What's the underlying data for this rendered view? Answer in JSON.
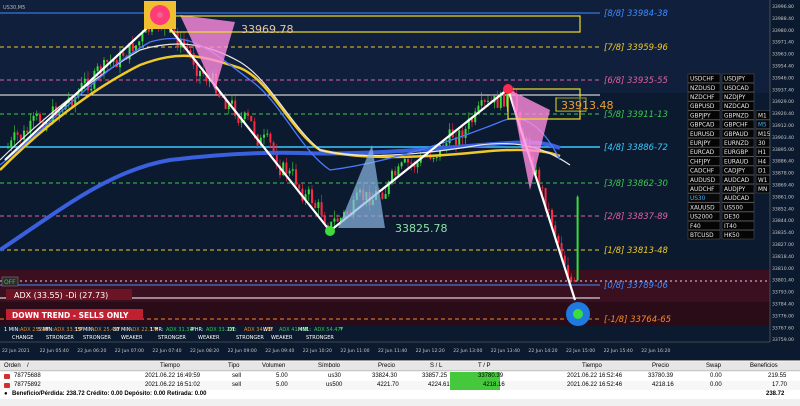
{
  "chart": {
    "title": "US30,M5",
    "labels": {
      "top_box": "33969.78",
      "right_box": "33913.48",
      "bottom_box": "33825.78"
    },
    "levels": [
      {
        "text": "[8/8]  33984-38",
        "color": "#3c8cff"
      },
      {
        "text": "[7/8]  33959-96",
        "color": "#f0c828"
      },
      {
        "text": "[6/8]  33935-55",
        "color": "#e060a0"
      },
      {
        "text": "[5/8]  33911-13",
        "color": "#3cc850"
      },
      {
        "text": "[4/8]  33886-72",
        "color": "#3cc8ff"
      },
      {
        "text": "[3/8]  33862-30",
        "color": "#3cc850"
      },
      {
        "text": "[2/8]  33837-89",
        "color": "#e060a0"
      },
      {
        "text": "[1/8]  33813-48",
        "color": "#f0c828"
      },
      {
        "text": "[0/8]  33789-06",
        "color": "#3c8cff"
      },
      {
        "text": "[-1/8]  33764-65",
        "color": "#f08a28"
      }
    ],
    "price_ticks": [
      "33996.80",
      "33988.40",
      "33980.00",
      "33971.40",
      "33963.00",
      "33954.40",
      "33946.00",
      "33937.40",
      "33929.00",
      "33920.40",
      "33912.00",
      "33903.40",
      "33895.00",
      "33886.40",
      "33878.00",
      "33869.40",
      "33861.00",
      "33852.40",
      "33844.00",
      "33835.40",
      "33827.00",
      "33818.40",
      "33810.00",
      "33801.40",
      "33793.00",
      "33784.40",
      "33776.00",
      "33767.60",
      "33759.00"
    ],
    "time_ticks": [
      "22 Jun 2021",
      "22 Jun 05:40",
      "22 Jun 06:20",
      "22 Jun 07:00",
      "22 Jun 07:40",
      "22 Jun 08:20",
      "22 Jun 09:00",
      "22 Jun 09:40",
      "22 Jun 10:20",
      "22 Jun 11:00",
      "22 Jun 11:40",
      "22 Jun 12:20",
      "22 Jun 13:00",
      "22 Jun 13:40",
      "22 Jun 14:20",
      "22 Jun 15:00",
      "22 Jun 15:40",
      "22 Jun 16:20"
    ],
    "adx_label": "ADX (33.55)  -Di (27.73)",
    "trend_label": "DOWN TREND - SELLS ONLY",
    "off_label": "OFF",
    "timeframes": [
      {
        "tf": "1 MIN:",
        "adx": "ADX 25.50",
        "state": "CHANGE",
        "color": "#f08a28"
      },
      {
        "tf": "5 MIN:",
        "adx": "ADX 33.55",
        "state": "STRONGER",
        "color": "#f08a28"
      },
      {
        "tf": "15 MIN:",
        "adx": "ADX 25.40",
        "state": "STRONGER",
        "color": "#f08a28"
      },
      {
        "tf": "30 MIN:",
        "adx": "ADX 22.37",
        "state": "WEAKER",
        "color": "#f08a28"
      },
      {
        "tf": "1 HR:",
        "adx": "ADX 31.31",
        "state": "STRONGER",
        "color": "#3cc850"
      },
      {
        "tf": "4 HR:",
        "adx": "ADX 33.20",
        "state": "WEAKER",
        "color": "#3cc850"
      },
      {
        "tf": "D1:",
        "adx": "ADX 34.58",
        "state": "STRONGER",
        "color": "#f08a28"
      },
      {
        "tf": "W1:",
        "adx": "ADX 41.46",
        "state": "WEAKER",
        "color": "#3cc850"
      },
      {
        "tf": "MN1:",
        "adx": "ADX 54.47",
        "state": "STRONGER",
        "color": "#3cc850"
      }
    ],
    "symbol_rows": [
      [
        "USDCHF",
        "USDJPY",
        ""
      ],
      [
        "NZDUSD",
        "USDCAD",
        ""
      ],
      [
        "NZDCHF",
        "NZDJPY",
        ""
      ],
      [
        "GBPUSD",
        "NZDCAD",
        ""
      ],
      [
        "GBPJPY",
        "GBPNZD",
        "M1"
      ],
      [
        "GBPCAD",
        "GBPCHF",
        "M5"
      ],
      [
        "EURUSD",
        "GBPAUD",
        "M15"
      ],
      [
        "EURJPY",
        "EURNZD",
        "30"
      ],
      [
        "EURCAD",
        "EURGBP",
        "H1"
      ],
      [
        "CHFJPY",
        "EURAUD",
        "H4"
      ],
      [
        "CADCHF",
        "CADJPY",
        "D1"
      ],
      [
        "AUDUSD",
        "AUDCAD",
        "W1"
      ],
      [
        "AUDCHF",
        "AUDJPY",
        "MN"
      ],
      [
        "US30",
        "AUDCAD",
        ""
      ],
      [
        "XAUUSD",
        "US500",
        ""
      ],
      [
        "US2000",
        "DE30",
        ""
      ],
      [
        "F40",
        "IT40",
        ""
      ],
      [
        "BTCUSD",
        "HK50",
        ""
      ]
    ]
  },
  "terminal": {
    "headers": [
      "Orden",
      "/",
      "Tiempo",
      "Tipo",
      "Volumen",
      "Símbolo",
      "Precio",
      "S / L",
      "T / P",
      "Tiempo",
      "Precio",
      "Swap",
      "Beneficios"
    ],
    "rows": [
      [
        "78775688",
        "2021.06.22 16:49:59",
        "sell",
        "5.00",
        "us30",
        "33824.30",
        "33857.25",
        "33780.39",
        "2021.06.22 16:52:46",
        "33780.39",
        "0.00",
        "219.55"
      ],
      [
        "78775892",
        "2021.06.22 16:51:02",
        "sell",
        "5.00",
        "us500",
        "4221.70",
        "4224.61",
        "4218.16",
        "2021.06.22 16:52:46",
        "4218.16",
        "0.00",
        "17.70"
      ]
    ],
    "summary": "Beneficio/Pérdida: 238.72  Crédito: 0.00  Depósito: 0.00  Retirada: 0.00",
    "total": "238.72"
  },
  "colors": {
    "background": "#0b1a2e",
    "upper_zone": "#0d1c36",
    "lower_zone": "#3a1020",
    "tp_highlight": "#46c83c"
  }
}
